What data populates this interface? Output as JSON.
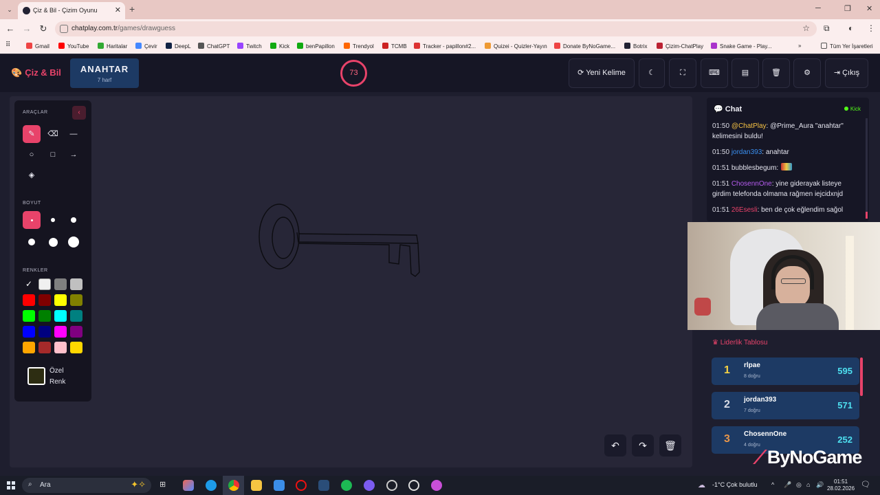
{
  "browser": {
    "tab_title": "Çiz & Bil - Çizim Oyunu",
    "url_host": "chatplay.com.tr",
    "url_path": "/games/drawguess",
    "bookmarks": [
      "Gmail",
      "YouTube",
      "Haritalar",
      "Çevir",
      "DeepL",
      "ChatGPT",
      "Twitch",
      "Kick",
      "benPapillon",
      "Trendyol",
      "TCMB",
      "Tracker - papillon#2...",
      "Quizei - Quizler-Yayın",
      "Donate ByNoGame...",
      "Botrix",
      "Çizim-ChatPlay",
      "Snake Game - Play..."
    ],
    "all_bookmarks": "Tüm Yer İşaretleri"
  },
  "header": {
    "logo": "Çiz & Bil",
    "word": "ANAHTAR",
    "word_hint": "7 harf",
    "timer": "73",
    "new_word": "Yeni Kelime",
    "logout": "Çıkış"
  },
  "tools": {
    "tools_label": "ARAÇLAR",
    "size_label": "BOYUT",
    "colors_label": "RENKLER",
    "custom_label_1": "Özel",
    "custom_label_2": "Renk",
    "custom_color": "#2d2d12",
    "swatches": [
      "#ffffff",
      "#f0f0f0",
      "#808080",
      "#c0c0c0",
      "#ff0000",
      "#800000",
      "#ffff00",
      "#808000",
      "#00ff00",
      "#008000",
      "#00ffff",
      "#008080",
      "#0000ff",
      "#000080",
      "#ff00ff",
      "#800080",
      "#ffa500",
      "#a52a2a",
      "#ffc0cb",
      "#ffd700"
    ]
  },
  "chat": {
    "title": "Chat",
    "source": "Kick",
    "messages": [
      {
        "time": "01:50",
        "user": "@ChatPlay",
        "user_color": "#f6c244",
        "text": ": @Prime_Aura \"anahtar\" kelimesini buldu!"
      },
      {
        "time": "01:50",
        "user": "jordan393",
        "user_color": "#3a8ff0",
        "text": ": anahtar"
      },
      {
        "time": "01:51",
        "user": "bubblesbegum",
        "user_color": "#e6e6f0",
        "text": ":"
      },
      {
        "time": "01:51",
        "user": "ChosennOne",
        "user_color": "#b65cf0",
        "text": ": yine giderayak listeye girdim telefonda olmama rağmen iejcidxnjd"
      },
      {
        "time": "01:51",
        "user": "26Esesli",
        "user_color": "#e8436a",
        "text": ": ben de çok eğlendim sağol"
      }
    ]
  },
  "leaderboard": {
    "title": "Liderlik Tablosu",
    "rows": [
      {
        "rank": "1",
        "rank_color": "#f6d244",
        "name": "rlpae",
        "sub": "8 doğru",
        "score": "595"
      },
      {
        "rank": "2",
        "rank_color": "#d8dce6",
        "name": "jordan393",
        "sub": "7 doğru",
        "score": "571"
      },
      {
        "rank": "3",
        "rank_color": "#e8964a",
        "name": "ChosennOne",
        "sub": "4 doğru",
        "score": "252"
      }
    ]
  },
  "overlay_brand": "ByNoGame",
  "taskbar": {
    "search": "Ara",
    "weather": "-1°C  Çok bulutlu",
    "time": "01:51",
    "date": "28.02.2026"
  }
}
